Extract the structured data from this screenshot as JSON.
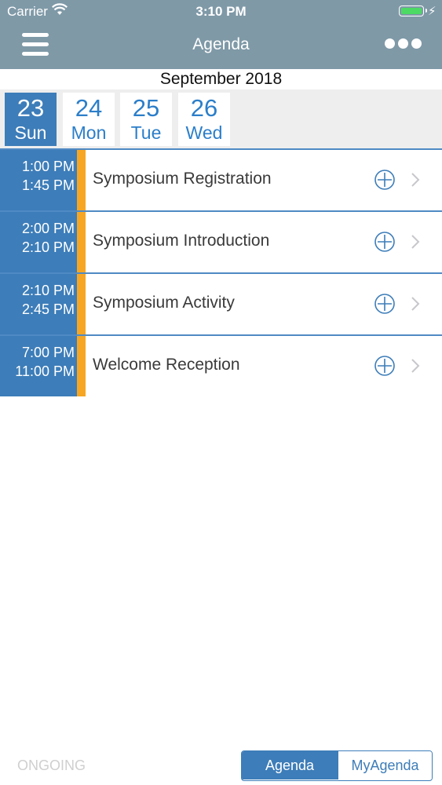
{
  "status_bar": {
    "carrier": "Carrier",
    "time": "3:10 PM",
    "wifi_icon": "wifi-icon",
    "battery_icon": "battery-icon",
    "battery_level": 1.0
  },
  "nav": {
    "title": "Agenda",
    "menu_icon": "hamburger-icon",
    "more_icon": "more-dots-icon"
  },
  "calendar": {
    "month": "September 2018",
    "days": [
      {
        "num": "23",
        "dow": "Sun",
        "selected": true
      },
      {
        "num": "24",
        "dow": "Mon",
        "selected": false
      },
      {
        "num": "25",
        "dow": "Tue",
        "selected": false
      },
      {
        "num": "26",
        "dow": "Wed",
        "selected": false
      }
    ]
  },
  "sessions": [
    {
      "start": "1:00 PM",
      "end": "1:45 PM",
      "title": "Symposium Registration"
    },
    {
      "start": "2:00 PM",
      "end": "2:10 PM",
      "title": "Symposium Introduction"
    },
    {
      "start": "2:10 PM",
      "end": "2:45 PM",
      "title": "Symposium Activity"
    },
    {
      "start": "7:00 PM",
      "end": "11:00 PM",
      "title": "Welcome Reception"
    }
  ],
  "footer": {
    "ongoing": "ONGOING",
    "segments": [
      "Agenda",
      "MyAgenda"
    ],
    "selected_segment": "Agenda"
  },
  "colors": {
    "header": "#7f99a7",
    "primary_blue": "#3d7db9",
    "accent_orange": "#f6a623"
  }
}
